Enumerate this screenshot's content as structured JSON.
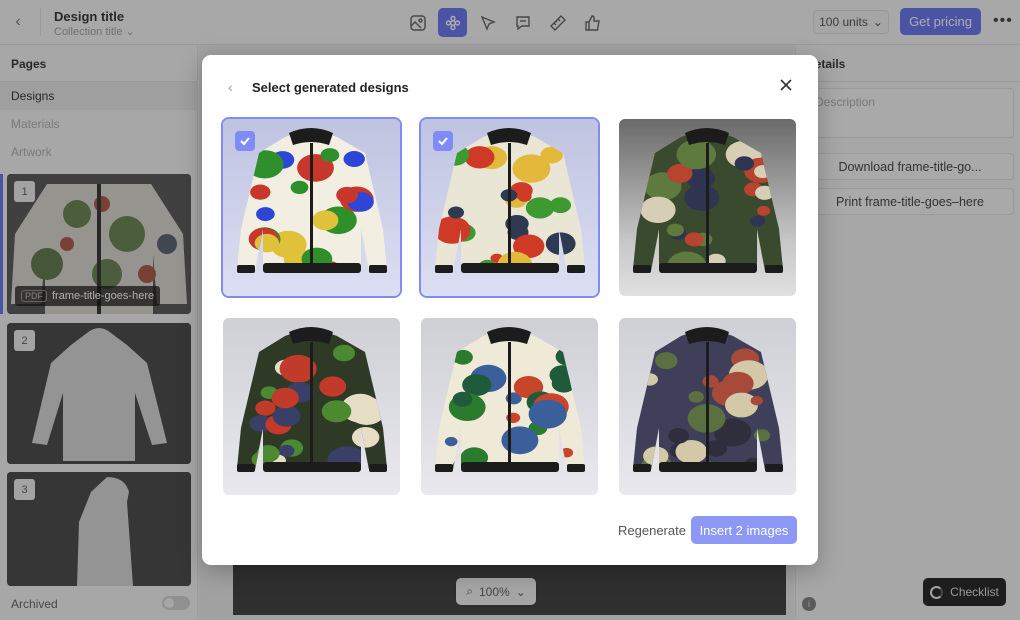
{
  "topbar": {
    "design_title": "Design title",
    "collection_title": "Collection title",
    "tools": [
      {
        "icon": "image-icon",
        "active": false
      },
      {
        "icon": "flower-settings-icon",
        "active": true
      },
      {
        "icon": "pointer-icon",
        "active": false
      },
      {
        "icon": "comment-icon",
        "active": false
      },
      {
        "icon": "ruler-icon",
        "active": false
      },
      {
        "icon": "thumbs-up-icon",
        "active": false
      }
    ],
    "units_label": "100 units",
    "pricing_label": "Get pricing",
    "more_label": "•••"
  },
  "sidebar": {
    "heading": "Pages",
    "items": [
      {
        "label": "Designs",
        "selected": true
      },
      {
        "label": "Materials",
        "selected": false
      },
      {
        "label": "Artwork",
        "selected": false
      }
    ],
    "pages": [
      {
        "number": "1",
        "badge": "PDF",
        "caption": "frame-title-goes-here",
        "selected": true
      },
      {
        "number": "2",
        "selected": false
      },
      {
        "number": "3",
        "selected": false
      }
    ],
    "archived_label": "Archived",
    "archived_on": false
  },
  "canvas": {
    "zoom_label": "100%"
  },
  "details": {
    "heading": "Details",
    "description_placeholder": "Description",
    "download_label": "Download frame-title-go...",
    "print_label": "Print frame-title-goes–here",
    "checklist_label": "Checklist"
  },
  "modal": {
    "title": "Select generated designs",
    "designs": [
      {
        "selected": true
      },
      {
        "selected": true
      },
      {
        "selected": false
      },
      {
        "selected": false
      },
      {
        "selected": false
      },
      {
        "selected": false
      }
    ],
    "regenerate_label": "Regenerate",
    "insert_label": "Insert 2 images"
  },
  "colors": {
    "accent": "#5b6af0",
    "accent_light": "#8d98f4"
  }
}
